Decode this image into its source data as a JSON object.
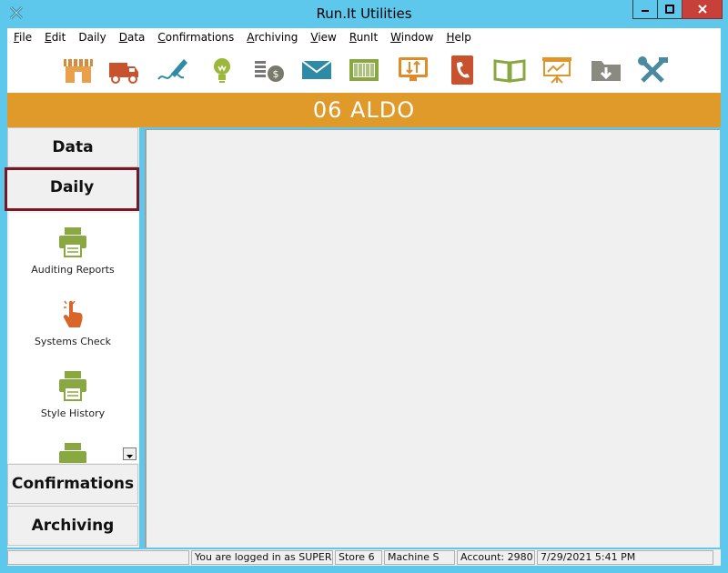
{
  "window": {
    "title": "Run.It Utilities",
    "title_color": "#5ec8ec"
  },
  "menubar": {
    "items": [
      {
        "label": "File",
        "accel": "F",
        "rest": "ile"
      },
      {
        "label": "Edit",
        "accel": "E",
        "rest": "dit"
      },
      {
        "label": "Daily",
        "accel": "",
        "rest": "Daily"
      },
      {
        "label": "Data",
        "accel": "D",
        "rest": "ata"
      },
      {
        "label": "Confirmations",
        "accel": "C",
        "rest": "onfirmations"
      },
      {
        "label": "Archiving",
        "accel": "A",
        "rest": "rchiving"
      },
      {
        "label": "View",
        "accel": "V",
        "rest": "iew"
      },
      {
        "label": "RunIt",
        "accel": "R",
        "rest": "unIt"
      },
      {
        "label": "Window",
        "accel": "W",
        "rest": "indow"
      },
      {
        "label": "Help",
        "accel": "H",
        "rest": "elp"
      }
    ]
  },
  "toolbar": {
    "icons": [
      "store-icon",
      "truck-icon",
      "signature-icon",
      "lightbulb-icon",
      "money-icon",
      "mail-icon",
      "barcode-icon",
      "monitor-transfer-icon",
      "phone-book-icon",
      "open-book-icon",
      "presentation-icon",
      "download-folder-icon",
      "tools-icon"
    ]
  },
  "banner": {
    "text": "06 ALDO",
    "color": "#e09a2a"
  },
  "sidebar": {
    "data_label": "Data",
    "daily_label": "Daily",
    "confirmations_label": "Confirmations",
    "archiving_label": "Archiving",
    "selected_border_color": "#7a1724",
    "items": [
      {
        "label": "Auditing Reports",
        "icon": "printer-icon"
      },
      {
        "label": "Systems Check",
        "icon": "hand-pointer-icon"
      },
      {
        "label": "Style History",
        "icon": "printer-icon"
      }
    ]
  },
  "status": {
    "user": "You are logged in as SUPER",
    "store": "Store 6",
    "machine": "Machine S",
    "account": "Account: 2980",
    "datetime": "7/29/2021 5:41 PM"
  }
}
